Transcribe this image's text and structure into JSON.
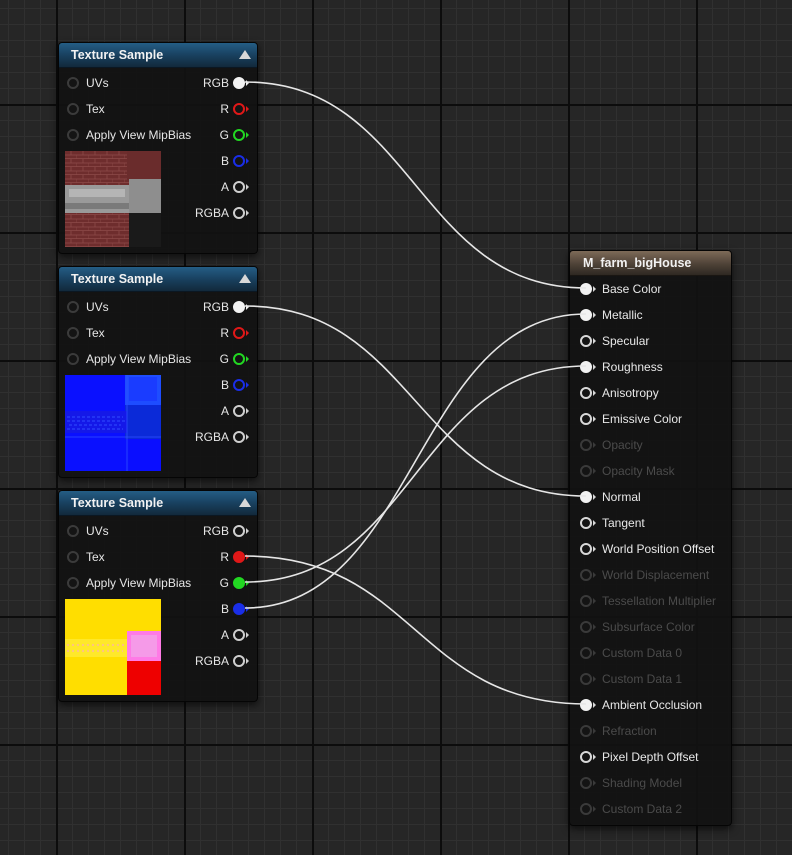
{
  "colors": {
    "wire": "#e6e6e6",
    "pin_r": "#e01818",
    "pin_g": "#22d822",
    "pin_b": "#1a2ee8",
    "pin_white": "#f2f2f2",
    "tex_header": "#1e4d70",
    "mat_header": "#6b5a4b"
  },
  "texture_nodes": [
    {
      "title": "Texture Sample",
      "inputs": [
        "UVs",
        "Tex",
        "Apply View MipBias"
      ],
      "outputs": [
        {
          "label": "RGB",
          "connected": true
        },
        {
          "label": "R",
          "connected": false
        },
        {
          "label": "G",
          "connected": false
        },
        {
          "label": "B",
          "connected": false
        },
        {
          "label": "A",
          "connected": false
        },
        {
          "label": "RGBA",
          "connected": false
        }
      ],
      "preview": "brick-basecolor-texture"
    },
    {
      "title": "Texture Sample",
      "inputs": [
        "UVs",
        "Tex",
        "Apply View MipBias"
      ],
      "outputs": [
        {
          "label": "RGB",
          "connected": true
        },
        {
          "label": "R",
          "connected": false
        },
        {
          "label": "G",
          "connected": false
        },
        {
          "label": "B",
          "connected": false
        },
        {
          "label": "A",
          "connected": false
        },
        {
          "label": "RGBA",
          "connected": false
        }
      ],
      "preview": "normal-map-texture"
    },
    {
      "title": "Texture Sample",
      "inputs": [
        "UVs",
        "Tex",
        "Apply View MipBias"
      ],
      "outputs": [
        {
          "label": "RGB",
          "connected": false
        },
        {
          "label": "R",
          "connected": true
        },
        {
          "label": "G",
          "connected": true
        },
        {
          "label": "B",
          "connected": true
        },
        {
          "label": "A",
          "connected": false
        },
        {
          "label": "RGBA",
          "connected": false
        }
      ],
      "preview": "orm-mask-texture"
    }
  ],
  "material_node": {
    "title": "M_farm_bigHouse",
    "inputs": [
      {
        "label": "Base Color",
        "enabled": true,
        "connected": true
      },
      {
        "label": "Metallic",
        "enabled": true,
        "connected": true
      },
      {
        "label": "Specular",
        "enabled": true,
        "connected": false
      },
      {
        "label": "Roughness",
        "enabled": true,
        "connected": true
      },
      {
        "label": "Anisotropy",
        "enabled": true,
        "connected": false
      },
      {
        "label": "Emissive Color",
        "enabled": true,
        "connected": false
      },
      {
        "label": "Opacity",
        "enabled": false,
        "connected": false
      },
      {
        "label": "Opacity Mask",
        "enabled": false,
        "connected": false
      },
      {
        "label": "Normal",
        "enabled": true,
        "connected": true
      },
      {
        "label": "Tangent",
        "enabled": true,
        "connected": false
      },
      {
        "label": "World Position Offset",
        "enabled": true,
        "connected": false
      },
      {
        "label": "World Displacement",
        "enabled": false,
        "connected": false
      },
      {
        "label": "Tessellation Multiplier",
        "enabled": false,
        "connected": false
      },
      {
        "label": "Subsurface Color",
        "enabled": false,
        "connected": false
      },
      {
        "label": "Custom Data 0",
        "enabled": false,
        "connected": false
      },
      {
        "label": "Custom Data 1",
        "enabled": false,
        "connected": false
      },
      {
        "label": "Ambient Occlusion",
        "enabled": true,
        "connected": true
      },
      {
        "label": "Refraction",
        "enabled": false,
        "connected": false
      },
      {
        "label": "Pixel Depth Offset",
        "enabled": true,
        "connected": false
      },
      {
        "label": "Shading Model",
        "enabled": false,
        "connected": false
      },
      {
        "label": "Custom Data 2",
        "enabled": false,
        "connected": false
      }
    ]
  },
  "connections": [
    {
      "from_node": 0,
      "from_pin": "RGB",
      "to_pin": "Base Color"
    },
    {
      "from_node": 1,
      "from_pin": "RGB",
      "to_pin": "Normal"
    },
    {
      "from_node": 2,
      "from_pin": "R",
      "to_pin": "Ambient Occlusion"
    },
    {
      "from_node": 2,
      "from_pin": "G",
      "to_pin": "Roughness"
    },
    {
      "from_node": 2,
      "from_pin": "B",
      "to_pin": "Metallic"
    }
  ]
}
